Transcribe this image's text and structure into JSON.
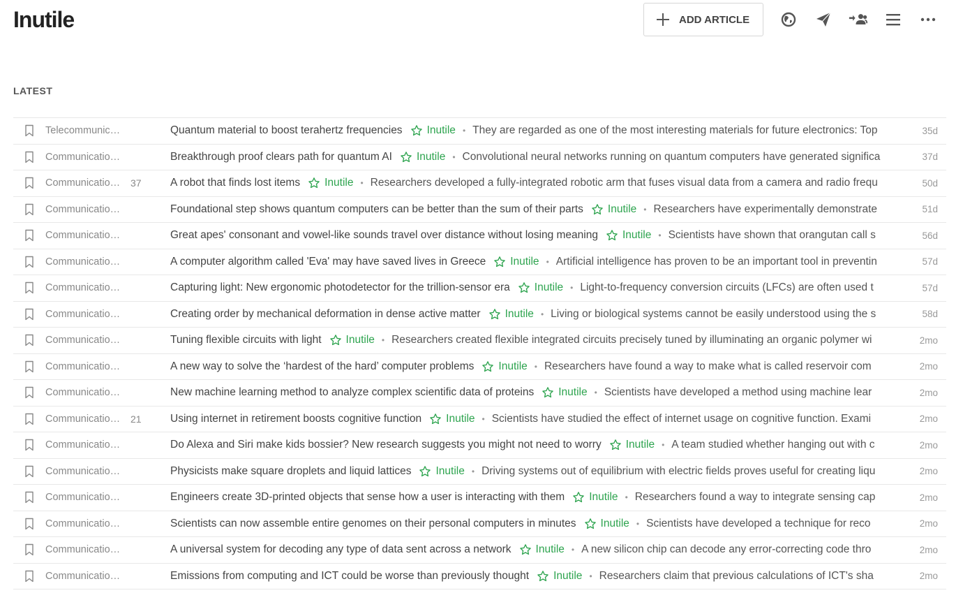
{
  "header": {
    "title": "Inutile",
    "add_article_label": "ADD ARTICLE"
  },
  "toolbar_icons": [
    "globe-icon",
    "send-icon",
    "followers-icon",
    "menu-icon",
    "more-icon"
  ],
  "section": {
    "label": "LATEST"
  },
  "colors": {
    "accent": "#2ea44f",
    "muted": "#888888",
    "border": "#e8e8e8"
  },
  "articles": [
    {
      "source": "Telecommunic…",
      "count": "",
      "title": "Quantum material to boost terahertz frequencies",
      "feed": "Inutile",
      "summary": "They are regarded as one of the most interesting materials for future electronics: Top",
      "age": "35d"
    },
    {
      "source": "Communicatio…",
      "count": "",
      "title": "Breakthrough proof clears path for quantum AI",
      "feed": "Inutile",
      "summary": "Convolutional neural networks running on quantum computers have generated significa",
      "age": "37d"
    },
    {
      "source": "Communicatio…",
      "count": "37",
      "title": "A robot that finds lost items",
      "feed": "Inutile",
      "summary": "Researchers developed a fully-integrated robotic arm that fuses visual data from a camera and radio frequ",
      "age": "50d"
    },
    {
      "source": "Communicatio…",
      "count": "",
      "title": "Foundational step shows quantum computers can be better than the sum of their parts",
      "feed": "Inutile",
      "summary": "Researchers have experimentally demonstrate",
      "age": "51d"
    },
    {
      "source": "Communicatio…",
      "count": "",
      "title": "Great apes' consonant and vowel-like sounds travel over distance without losing meaning",
      "feed": "Inutile",
      "summary": "Scientists have shown that orangutan call s",
      "age": "56d"
    },
    {
      "source": "Communicatio…",
      "count": "",
      "title": "A computer algorithm called 'Eva' may have saved lives in Greece",
      "feed": "Inutile",
      "summary": "Artificial intelligence has proven to be an important tool in preventin",
      "age": "57d"
    },
    {
      "source": "Communicatio…",
      "count": "",
      "title": "Capturing light: New ergonomic photodetector for the trillion-sensor era",
      "feed": "Inutile",
      "summary": "Light-to-frequency conversion circuits (LFCs) are often used t",
      "age": "57d"
    },
    {
      "source": "Communicatio…",
      "count": "",
      "title": "Creating order by mechanical deformation in dense active matter",
      "feed": "Inutile",
      "summary": "Living or biological systems cannot be easily understood using the s",
      "age": "58d"
    },
    {
      "source": "Communicatio…",
      "count": "",
      "title": "Tuning flexible circuits with light",
      "feed": "Inutile",
      "summary": "Researchers created flexible integrated circuits precisely tuned by illuminating an organic polymer wi",
      "age": "2mo"
    },
    {
      "source": "Communicatio…",
      "count": "",
      "title": "A new way to solve the ‘hardest of the hard’ computer problems",
      "feed": "Inutile",
      "summary": "Researchers have found a way to make what is called reservoir com",
      "age": "2mo"
    },
    {
      "source": "Communicatio…",
      "count": "",
      "title": "New machine learning method to analyze complex scientific data of proteins",
      "feed": "Inutile",
      "summary": "Scientists have developed a method using machine lear",
      "age": "2mo"
    },
    {
      "source": "Communicatio…",
      "count": "21",
      "title": "Using internet in retirement boosts cognitive function",
      "feed": "Inutile",
      "summary": "Scientists have studied the effect of internet usage on cognitive function. Exami",
      "age": "2mo"
    },
    {
      "source": "Communicatio…",
      "count": "",
      "title": "Do Alexa and Siri make kids bossier? New research suggests you might not need to worry",
      "feed": "Inutile",
      "summary": "A team studied whether hanging out with c",
      "age": "2mo"
    },
    {
      "source": "Communicatio…",
      "count": "",
      "title": "Physicists make square droplets and liquid lattices",
      "feed": "Inutile",
      "summary": "Driving systems out of equilibrium with electric fields proves useful for creating liqu",
      "age": "2mo"
    },
    {
      "source": "Communicatio…",
      "count": "",
      "title": "Engineers create 3D-printed objects that sense how a user is interacting with them",
      "feed": "Inutile",
      "summary": "Researchers found a way to integrate sensing cap",
      "age": "2mo"
    },
    {
      "source": "Communicatio…",
      "count": "",
      "title": "Scientists can now assemble entire genomes on their personal computers in minutes",
      "feed": "Inutile",
      "summary": "Scientists have developed a technique for reco",
      "age": "2mo"
    },
    {
      "source": "Communicatio…",
      "count": "",
      "title": "A universal system for decoding any type of data sent across a network",
      "feed": "Inutile",
      "summary": "A new silicon chip can decode any error-correcting code thro",
      "age": "2mo"
    },
    {
      "source": "Communicatio…",
      "count": "",
      "title": "Emissions from computing and ICT could be worse than previously thought",
      "feed": "Inutile",
      "summary": "Researchers claim that previous calculations of ICT's sha",
      "age": "2mo"
    }
  ]
}
